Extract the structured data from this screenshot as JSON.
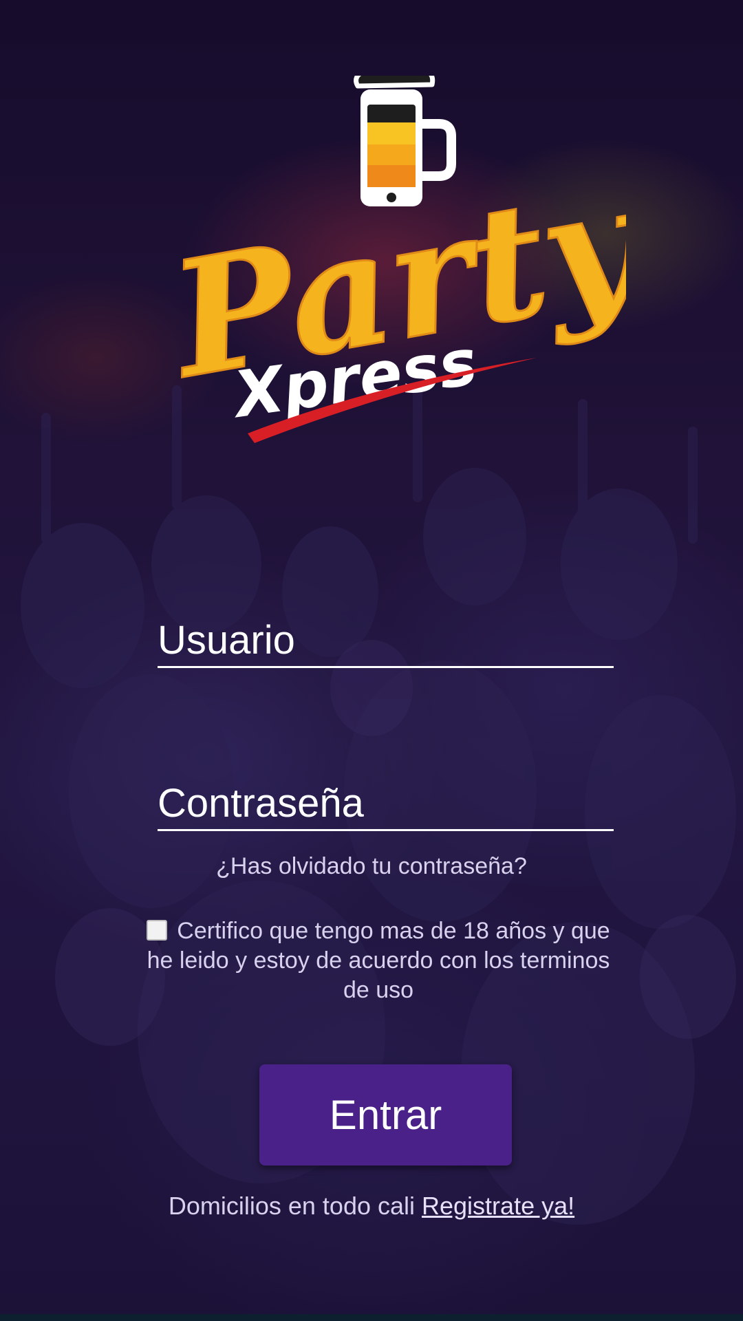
{
  "login": {
    "username_placeholder": "Usuario",
    "password_placeholder": "Contraseña",
    "forgot_password_link": "¿Has olvidado tu contraseña?",
    "terms_text": "Certifico que tengo mas de 18 años y que he leido y estoy de acuerdo con los terminos de uso",
    "terms_checked": false,
    "submit_label": "Entrar"
  },
  "footer": {
    "text": "Domicilios en todo cali ",
    "register_link": "Registrate ya!"
  },
  "brand": {
    "logo_text_top": "Party",
    "logo_text_bottom": "Xpress"
  },
  "colors": {
    "button_bg": "#4a2189",
    "logo_yellow": "#f5b41e",
    "logo_red": "#d91f26",
    "text": "#ffffff"
  }
}
